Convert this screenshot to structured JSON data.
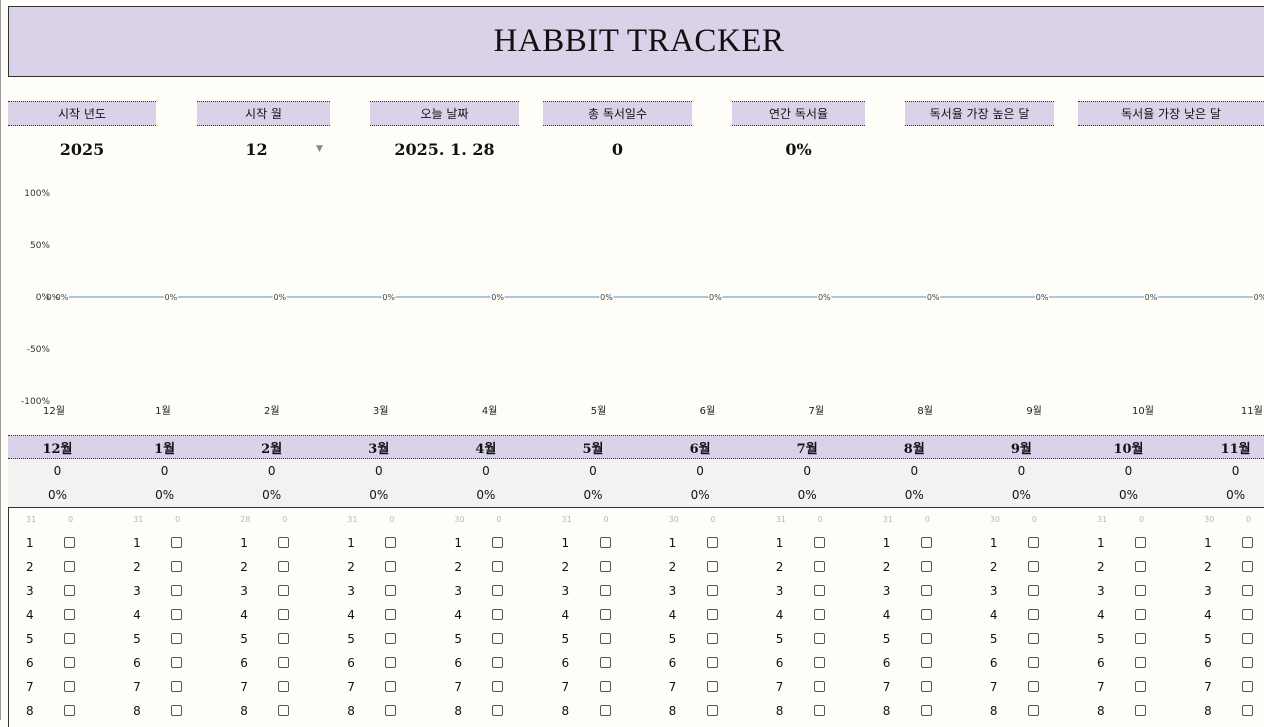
{
  "title": "HABBIT TRACKER",
  "stats": [
    {
      "label": "시작 년도",
      "value": "2025"
    },
    {
      "label": "시작 월",
      "value": "12"
    },
    {
      "label": "오늘 날짜",
      "value": "2025. 1. 28"
    },
    {
      "label": "총 독서일수",
      "value": "0"
    },
    {
      "label": "연간 독서율",
      "value": "0%"
    },
    {
      "label": "독서율 가장 높은 달",
      "value": ""
    },
    {
      "label": "독서율 가장 낮은 달",
      "value": ""
    }
  ],
  "chart_data": {
    "type": "line",
    "categories": [
      "12월",
      "1월",
      "2월",
      "3월",
      "4월",
      "5월",
      "6월",
      "7월",
      "8월",
      "9월",
      "10월",
      "11월"
    ],
    "values": [
      0,
      0,
      0,
      0,
      0,
      0,
      0,
      0,
      0,
      0,
      0,
      0
    ],
    "value_labels": [
      "0%",
      "0%",
      "0%",
      "0%",
      "0%",
      "0%",
      "0%",
      "0%",
      "0%",
      "0%",
      "0%",
      "0%"
    ],
    "first_point_extra_label": "0%",
    "ylim": [
      -100,
      100
    ],
    "yticks": [
      "100%",
      "50%",
      "0%",
      "-50%",
      "-100%"
    ],
    "line_color": "#6fa8dc",
    "grid": false
  },
  "months": [
    {
      "name": "12월",
      "count": "0",
      "pct": "0%",
      "days": "31",
      "checked": "0"
    },
    {
      "name": "1월",
      "count": "0",
      "pct": "0%",
      "days": "31",
      "checked": "0"
    },
    {
      "name": "2월",
      "count": "0",
      "pct": "0%",
      "days": "28",
      "checked": "0"
    },
    {
      "name": "3월",
      "count": "0",
      "pct": "0%",
      "days": "31",
      "checked": "0"
    },
    {
      "name": "4월",
      "count": "0",
      "pct": "0%",
      "days": "30",
      "checked": "0"
    },
    {
      "name": "5월",
      "count": "0",
      "pct": "0%",
      "days": "31",
      "checked": "0"
    },
    {
      "name": "6월",
      "count": "0",
      "pct": "0%",
      "days": "30",
      "checked": "0"
    },
    {
      "name": "7월",
      "count": "0",
      "pct": "0%",
      "days": "31",
      "checked": "0"
    },
    {
      "name": "8월",
      "count": "0",
      "pct": "0%",
      "days": "31",
      "checked": "0"
    },
    {
      "name": "9월",
      "count": "0",
      "pct": "0%",
      "days": "30",
      "checked": "0"
    },
    {
      "name": "10월",
      "count": "0",
      "pct": "0%",
      "days": "31",
      "checked": "0"
    },
    {
      "name": "11월",
      "count": "0",
      "pct": "0%",
      "days": "30",
      "checked": "0"
    }
  ],
  "day_numbers": [
    "1",
    "2",
    "3",
    "4",
    "5",
    "6",
    "7",
    "8"
  ],
  "colors": {
    "header_band": "#d9d2e9",
    "summary_band": "#f2f2f2",
    "background": "#fffdf8",
    "line": "#6fa8dc"
  }
}
